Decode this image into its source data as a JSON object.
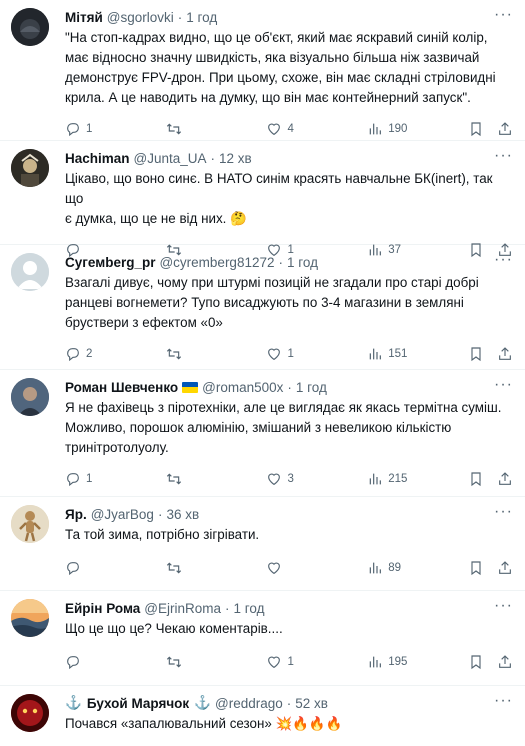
{
  "tweets": [
    {
      "name": "Мітяй",
      "handle": "@sgorlovki",
      "time": "1 год",
      "text": "\"На стоп-кадрах видно, що це об'єкт, який має яскравий синій колір,\nмає відносно значну швидкість, яка візуально більша ніж зазвичай\nдемонструє FPV-дрон. При цьому, схоже, він має складні стріловидні\nкрила. А це наводить на думку, що він має контейнерний запуск\".",
      "replies": "1",
      "retweets": "",
      "likes": "4",
      "views": "190"
    },
    {
      "name": "Hachiman",
      "handle": "@Junta_UA",
      "time": "12 хв",
      "text": "Цікаво, що воно синє. В НАТО синім красять навчальне БК(inert), так що\nє думка, що це не від них. 🤔",
      "replies": "",
      "retweets": "",
      "likes": "1",
      "views": "37"
    },
    {
      "name": "Cyгемberg_pr",
      "handle": "@cyremberg81272",
      "time": "1 год",
      "text": "Взагалі дивує, чому при штурмі позицій не згадали про старі добрі\nранцеві вогнемети? Тупо висаджують по 3-4 магазини в земляні\nбруствери з ефектом «0»",
      "replies": "2",
      "retweets": "",
      "likes": "1",
      "views": "151"
    },
    {
      "name": "Роман Шевченко",
      "handle": "@roman500x",
      "time": "1 год",
      "text": "Я не фахівець з піротехніки, але це виглядає як якась термітна суміш.\nМожливо, порошок алюмінію, змішаний з невеликою кількістю\nтринітротолуолу.",
      "replies": "1",
      "retweets": "",
      "likes": "3",
      "views": "215"
    },
    {
      "name": "Яр.",
      "handle": "@JyarBog",
      "time": "36 хв",
      "text": "Та той зима, потрібно зігрівати.",
      "replies": "",
      "retweets": "",
      "likes": "",
      "views": "89"
    },
    {
      "name": "Ейрін Рома",
      "handle": "@EjrinRoma",
      "time": "1 год",
      "text": "Що це що це? Чекаю коментарів....",
      "replies": "",
      "retweets": "",
      "likes": "1",
      "views": "195"
    },
    {
      "name": "Бухой Марячок",
      "handle": "@reddrago",
      "time": "52 хв",
      "text": "Почався «запалювальний сезон» 💥🔥🔥🔥",
      "replies": "",
      "retweets": "",
      "likes": "",
      "views": ""
    }
  ],
  "icons": {
    "reply": "reply-icon",
    "retweet": "retweet-icon",
    "like": "heart-icon",
    "views": "views-icon",
    "bookmark": "bookmark-icon",
    "share": "share-icon",
    "more": "more-icon",
    "anchor": "anchor-icon",
    "flag": "ukraine-flag-icon"
  },
  "colors": {
    "text": "#0f1419",
    "secondary": "#536471",
    "divider": "#eff3f4",
    "anchor": "#1d9bf0",
    "flag_blue": "#0057b7",
    "flag_yellow": "#ffd700"
  }
}
